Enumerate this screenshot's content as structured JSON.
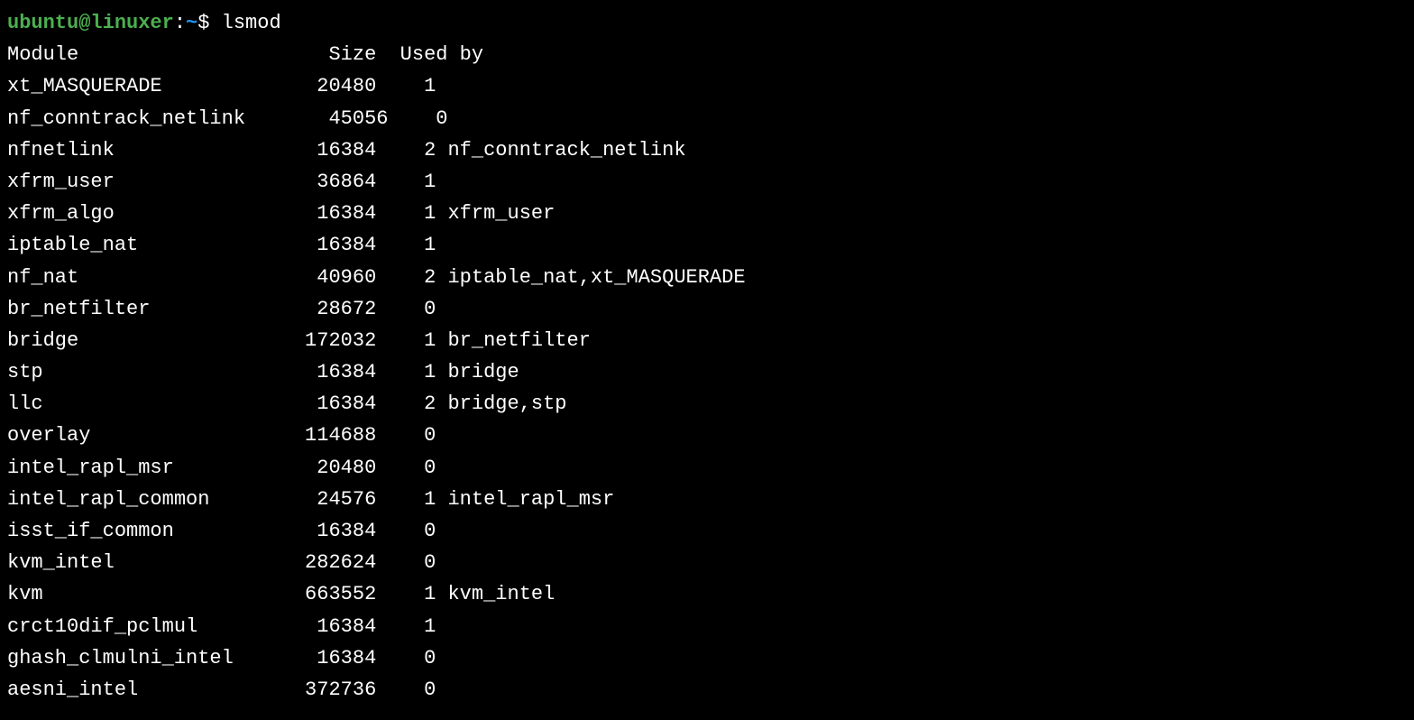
{
  "prompt": {
    "user": "ubuntu",
    "at": "@",
    "host": "linuxer",
    "colon": ":",
    "path": "~",
    "dollar": "$ "
  },
  "command": "lsmod",
  "header": {
    "module": "Module",
    "size": "Size",
    "usedby": "Used by"
  },
  "modules": [
    {
      "name": "xt_MASQUERADE",
      "size": "20480",
      "count": "1",
      "by": ""
    },
    {
      "name": "nf_conntrack_netlink",
      "size": "45056",
      "count": "0",
      "by": ""
    },
    {
      "name": "nfnetlink",
      "size": "16384",
      "count": "2",
      "by": "nf_conntrack_netlink"
    },
    {
      "name": "xfrm_user",
      "size": "36864",
      "count": "1",
      "by": ""
    },
    {
      "name": "xfrm_algo",
      "size": "16384",
      "count": "1",
      "by": "xfrm_user"
    },
    {
      "name": "iptable_nat",
      "size": "16384",
      "count": "1",
      "by": ""
    },
    {
      "name": "nf_nat",
      "size": "40960",
      "count": "2",
      "by": "iptable_nat,xt_MASQUERADE"
    },
    {
      "name": "br_netfilter",
      "size": "28672",
      "count": "0",
      "by": ""
    },
    {
      "name": "bridge",
      "size": "172032",
      "count": "1",
      "by": "br_netfilter"
    },
    {
      "name": "stp",
      "size": "16384",
      "count": "1",
      "by": "bridge"
    },
    {
      "name": "llc",
      "size": "16384",
      "count": "2",
      "by": "bridge,stp"
    },
    {
      "name": "overlay",
      "size": "114688",
      "count": "0",
      "by": ""
    },
    {
      "name": "intel_rapl_msr",
      "size": "20480",
      "count": "0",
      "by": ""
    },
    {
      "name": "intel_rapl_common",
      "size": "24576",
      "count": "1",
      "by": "intel_rapl_msr"
    },
    {
      "name": "isst_if_common",
      "size": "16384",
      "count": "0",
      "by": ""
    },
    {
      "name": "kvm_intel",
      "size": "282624",
      "count": "0",
      "by": ""
    },
    {
      "name": "kvm",
      "size": "663552",
      "count": "1",
      "by": "kvm_intel"
    },
    {
      "name": "crct10dif_pclmul",
      "size": "16384",
      "count": "1",
      "by": ""
    },
    {
      "name": "ghash_clmulni_intel",
      "size": "16384",
      "count": "0",
      "by": ""
    },
    {
      "name": "aesni_intel",
      "size": "372736",
      "count": "0",
      "by": ""
    }
  ]
}
